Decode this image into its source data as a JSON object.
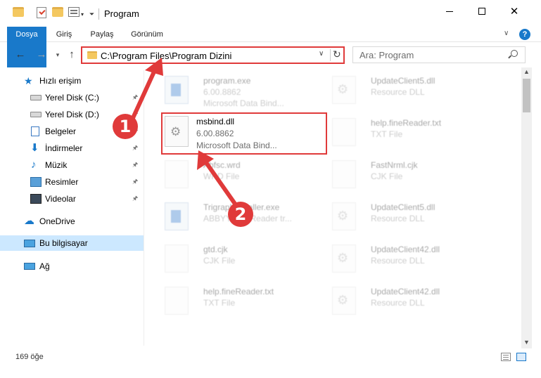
{
  "window": {
    "title": "Program",
    "min_label": "",
    "max_label": "",
    "close_label": "✕"
  },
  "ribbon": {
    "tabs": [
      "Dosya",
      "Giriş",
      "Paylaş",
      "Görünüm"
    ],
    "help": "?"
  },
  "nav": {
    "back": "←",
    "forward": "→",
    "recent": "▾",
    "up": "↑",
    "address": "C:\\Program Files\\Program Dizini",
    "address_dropdown": "∨",
    "refresh": "↻",
    "search_placeholder": "Ara: Program"
  },
  "sidebar": {
    "items": [
      {
        "label": "Hızlı erişim",
        "icon": "star-icon",
        "pinned": false
      },
      {
        "label": "Yerel Disk (C:)",
        "icon": "drive-icon",
        "pinned": true
      },
      {
        "label": "Yerel Disk (D:)",
        "icon": "drive-icon",
        "pinned": true
      },
      {
        "label": "Belgeler",
        "icon": "documents-icon",
        "pinned": true
      },
      {
        "label": "İndirmeler",
        "icon": "download-icon",
        "pinned": true
      },
      {
        "label": "Müzik",
        "icon": "music-icon",
        "pinned": true
      },
      {
        "label": "Resimler",
        "icon": "pictures-icon",
        "pinned": true
      },
      {
        "label": "Videolar",
        "icon": "videos-icon",
        "pinned": true
      },
      {
        "label": "OneDrive",
        "icon": "cloud-icon",
        "pinned": false
      },
      {
        "label": "Bu bilgisayar",
        "icon": "computer-icon",
        "pinned": false
      },
      {
        "label": "Ağ",
        "icon": "network-icon",
        "pinned": false
      }
    ],
    "pin_glyph": "📌"
  },
  "files": {
    "left": [
      {
        "name": "program.exe",
        "type": "6.00.8862",
        "desc": "Microsoft Data Bind..."
      },
      {
        "name": "Abfsc.wrd",
        "type": "WRD File",
        "desc": ""
      },
      {
        "name": "TrigraphInstaller.exe",
        "type": "ABBYY FineReader tr...",
        "desc": ""
      },
      {
        "name": "gtd.cjk",
        "type": "CJK File",
        "desc": ""
      },
      {
        "name": "help.fineReader.txt",
        "type": "TXT File",
        "desc": ""
      }
    ],
    "right": [
      {
        "name": "UpdateClient5.dll",
        "type": "Resource DLL",
        "desc": ""
      },
      {
        "name": "help.fineReader.txt",
        "type": "TXT File",
        "desc": ""
      },
      {
        "name": "FastNrml.cjk",
        "type": "CJK File",
        "desc": ""
      },
      {
        "name": "UpdateClient5.dll",
        "type": "Resource DLL",
        "desc": ""
      },
      {
        "name": "UpdateClient42.dll",
        "type": "Resource DLL",
        "desc": ""
      },
      {
        "name": "UpdateClient42.dll",
        "type": "Resource DLL",
        "desc": ""
      }
    ],
    "highlighted": {
      "name": "msbind.dll",
      "type": "6.00.8862",
      "desc": "Microsoft Data Bind..."
    }
  },
  "status": {
    "count": "169 öğe"
  },
  "annotations": {
    "badge1": "1",
    "badge2": "2",
    "color": "#e03a3a"
  }
}
